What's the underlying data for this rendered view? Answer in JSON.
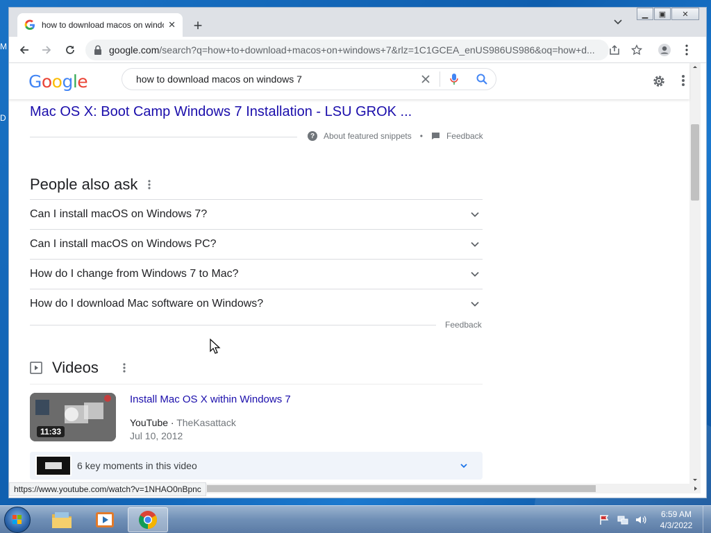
{
  "browser": {
    "tab_title": "how to download macos on windows 7",
    "url_host": "google.com",
    "url_rest": "/search?q=how+to+download+macos+on+windows+7&rlz=1C1GCEA_enUS986US986&oq=how+d..."
  },
  "google": {
    "logo": "Google",
    "query": "how to download macos on windows 7"
  },
  "featured": {
    "result_link": "Mac OS X: Boot Camp Windows 7 Installation - LSU GROK ...",
    "about_label": "About featured snippets",
    "separator": "•",
    "feedback": "Feedback"
  },
  "people_also_ask": {
    "title": "People also ask",
    "questions": [
      "Can I install macOS on Windows 7?",
      "Can I install macOS on Windows PC?",
      "How do I change from Windows 7 to Mac?",
      "How do I download Mac software on Windows?"
    ],
    "feedback": "Feedback"
  },
  "videos": {
    "title": "Videos",
    "item": {
      "title": "Install Mac OS X within Windows 7",
      "duration": "11:33",
      "source": "YouTube",
      "channel": "TheKasattack",
      "date": "Jul 10, 2012"
    },
    "key_moments": "6 key moments in this video"
  },
  "status_url": "https://www.youtube.com/watch?v=1NHAO0nBpnc",
  "desktop": {
    "icon_label_1": "M",
    "icon_label_2": "D"
  },
  "taskbar": {
    "time": "6:59 AM",
    "date": "4/3/2022"
  }
}
